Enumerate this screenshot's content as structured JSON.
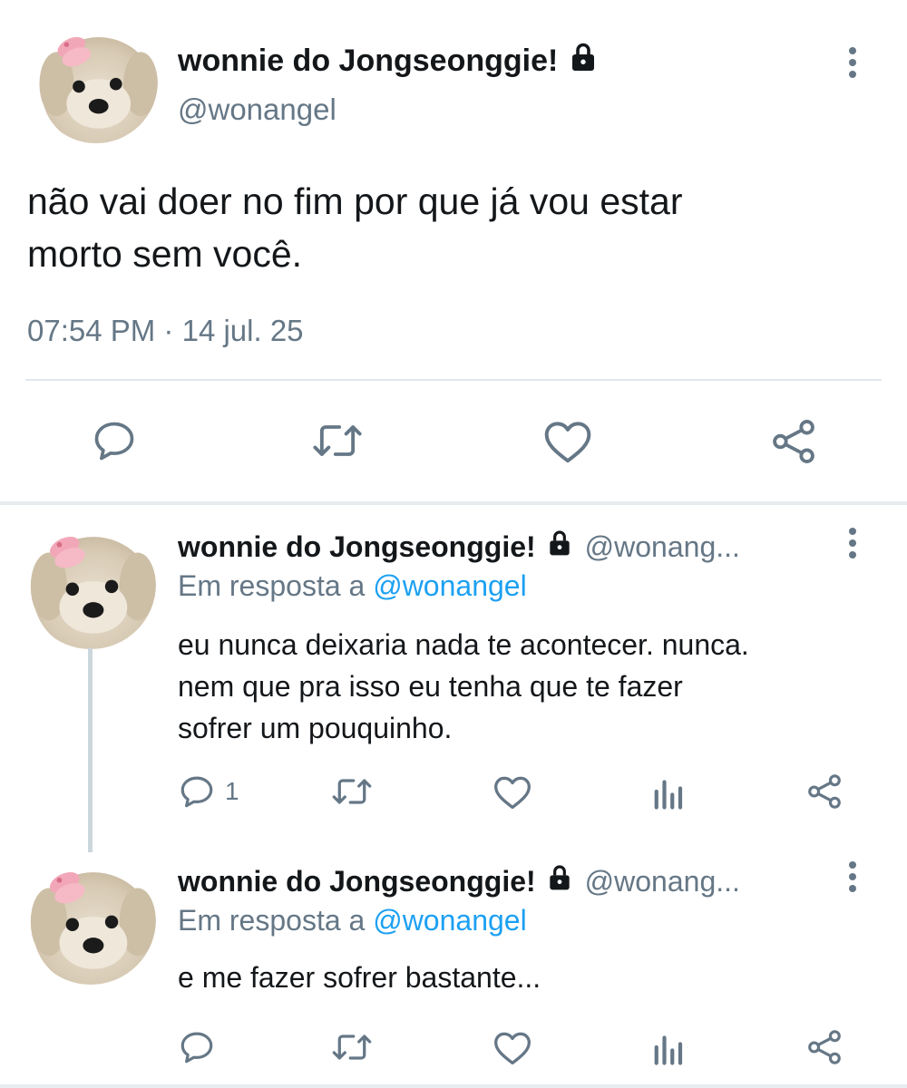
{
  "main_tweet": {
    "display_name": "wonnie do Jongseonggie!",
    "handle": "@wonangel",
    "text_line1": "não vai doer no fim por que já vou estar",
    "text_line2": "morto sem você.",
    "time": "07:54 PM",
    "separator": "·",
    "date": "14 jul. 25",
    "actions": [
      "reply",
      "retweet",
      "like",
      "share"
    ]
  },
  "replies": [
    {
      "display_name": "wonnie do Jongseonggie!",
      "handle": "@wonang...",
      "reply_to_prefix": "Em resposta a",
      "reply_to_handle": "@wonangel",
      "text_line1": "eu nunca deixaria nada te acontecer. nunca.",
      "text_line2": "nem que pra isso eu tenha que te fazer",
      "text_line3": "sofrer um pouquinho.",
      "reply_count": "1"
    },
    {
      "display_name": "wonnie do Jongseonggie!",
      "handle": "@wonang...",
      "reply_to_prefix": "Em resposta a",
      "reply_to_handle": "@wonangel",
      "text_line1": "e me fazer sofrer bastante...",
      "reply_count": ""
    }
  ],
  "icons": {
    "reply": "comment-icon",
    "retweet": "retweet-icon",
    "like": "heart-icon",
    "analytics": "analytics-icon",
    "share": "share-icon",
    "lock": "lock-icon",
    "more": "more-vertical-icon"
  },
  "colors": {
    "text": "#14171a",
    "secondary": "#657786",
    "link": "#1da1f2",
    "divider": "#e1e8ed",
    "thread_line": "#ccd6dd"
  }
}
